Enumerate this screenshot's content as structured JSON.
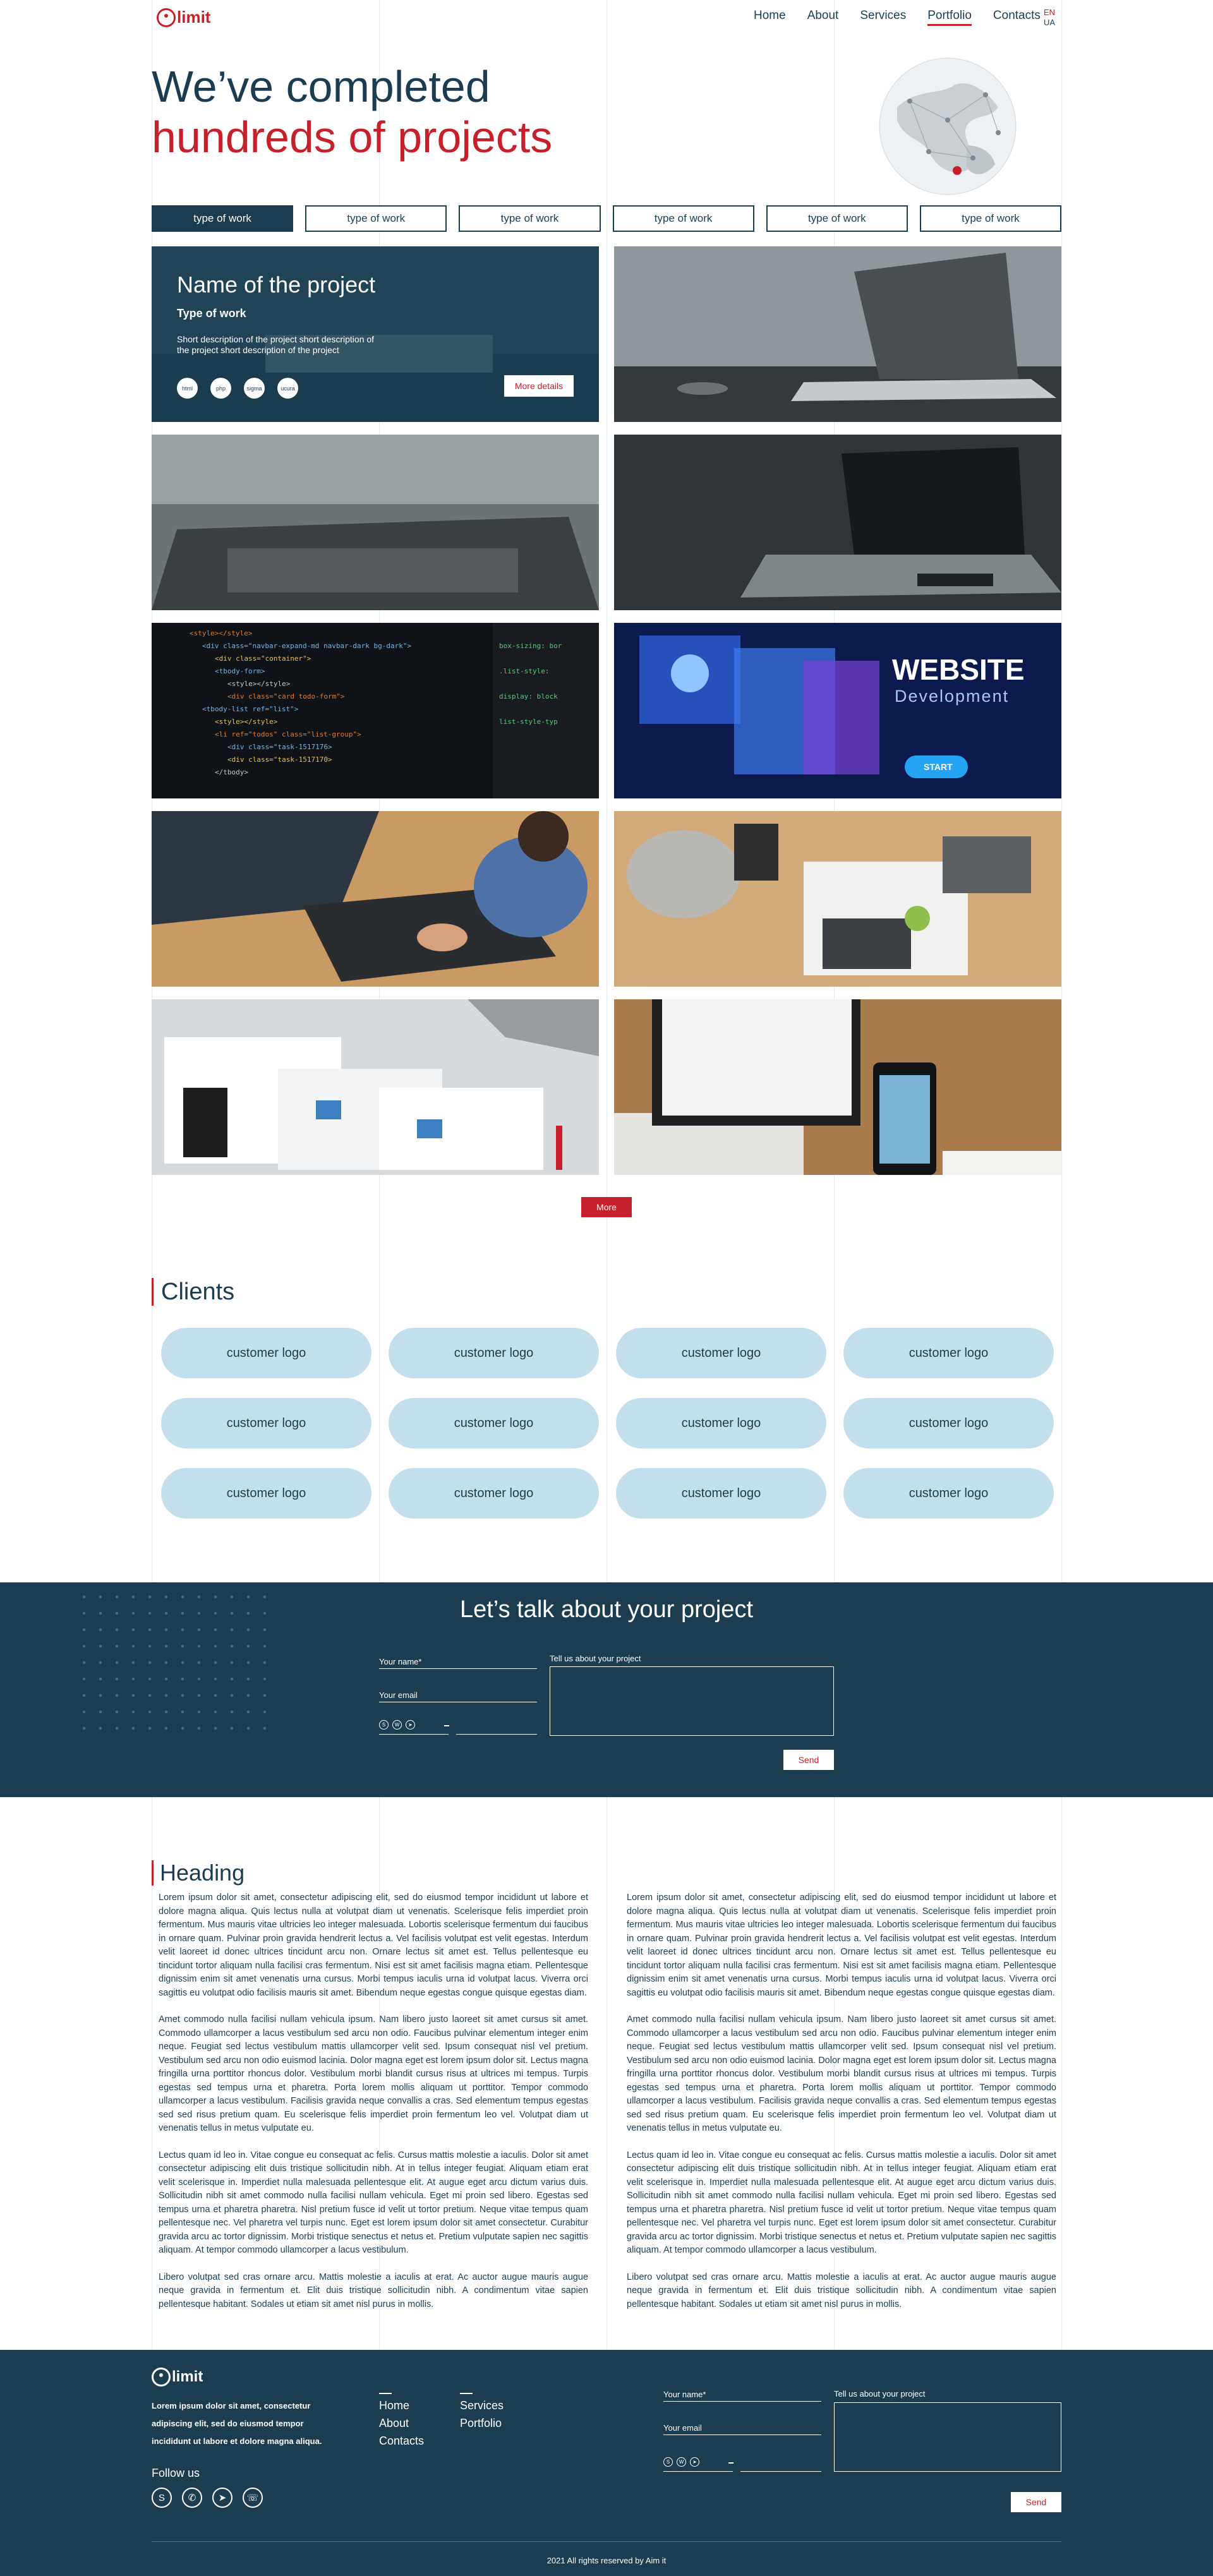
{
  "brand": {
    "name": "limit"
  },
  "nav": {
    "items": [
      "Home",
      "About",
      "Services",
      "Portfolio",
      "Contacts"
    ],
    "active": "Portfolio"
  },
  "lang": {
    "primary": "EN",
    "secondary": "UA"
  },
  "hero": {
    "line1": "We’ve completed",
    "line2": "hundreds of projects"
  },
  "filters": [
    "type of work",
    "type of work",
    "type of work",
    "type of work",
    "type of work",
    "type of work"
  ],
  "featured_project": {
    "title": "Name of the project",
    "type": "Type of work",
    "description": "Short description of the project short description of the project short description of the project",
    "tech": [
      "html",
      "php",
      "sigma",
      "ucura"
    ],
    "more_label": "More details"
  },
  "more_label": "More",
  "clients": {
    "title": "Clients",
    "logos": [
      "customer logo",
      "customer logo",
      "customer logo",
      "customer logo",
      "customer logo",
      "customer logo",
      "customer logo",
      "customer logo",
      "customer logo",
      "customer logo",
      "customer logo",
      "customer logo"
    ]
  },
  "contact": {
    "title": "Let’s talk about your project",
    "name_label": "Your name*",
    "email_label": "Your email",
    "message_label": "Tell us about your project",
    "send_label": "Send"
  },
  "article": {
    "heading": "Heading",
    "p1": "Lorem ipsum dolor sit amet, consectetur adipiscing elit, sed do eiusmod tempor incididunt ut labore et dolore magna aliqua. Quis lectus nulla at volutpat diam ut venenatis. Scelerisque felis imperdiet proin fermentum. Mus mauris vitae ultricies leo integer malesuada. Lobortis scelerisque fermentum dui faucibus in ornare quam. Pulvinar proin gravida hendrerit lectus a. Vel facilisis volutpat est velit egestas. Interdum velit laoreet id donec ultrices tincidunt arcu non. Ornare lectus sit amet est. Tellus pellentesque eu tincidunt tortor aliquam nulla facilisi cras fermentum. Nisi est sit amet facilisis magna etiam. Pellentesque dignissim enim sit amet venenatis urna cursus. Morbi tempus iaculis urna id volutpat lacus. Viverra orci sagittis eu volutpat odio facilisis mauris sit amet. Bibendum neque egestas congue quisque egestas diam.",
    "p2": "Amet commodo nulla facilisi nullam vehicula ipsum. Nam libero justo laoreet sit amet cursus sit amet. Commodo ullamcorper a lacus vestibulum sed arcu non odio. Faucibus pulvinar elementum integer enim neque. Feugiat sed lectus vestibulum mattis ullamcorper velit sed. Ipsum consequat nisl vel pretium. Vestibulum sed arcu non odio euismod lacinia. Dolor magna eget est lorem ipsum dolor sit. Lectus magna fringilla urna porttitor rhoncus dolor. Vestibulum morbi blandit cursus risus at ultrices mi tempus. Turpis egestas sed tempus urna et pharetra. Porta lorem mollis aliquam ut porttitor. Tempor commodo ullamcorper a lacus vestibulum. Facilisis gravida neque convallis a cras. Sed elementum tempus egestas sed sed risus pretium quam. Eu scelerisque felis imperdiet proin fermentum leo vel. Volutpat diam ut venenatis tellus in metus vulputate eu.",
    "p3": "Lectus quam id leo in. Vitae congue eu consequat ac felis. Cursus mattis molestie a iaculis. Dolor sit amet consectetur adipiscing elit duis tristique sollicitudin nibh. At in tellus integer feugiat. Aliquam etiam erat velit scelerisque in. Imperdiet nulla malesuada pellentesque elit. At augue eget arcu dictum varius duis. Sollicitudin nibh sit amet commodo nulla facilisi nullam vehicula. Eget mi proin sed libero. Egestas sed tempus urna et pharetra pharetra. Nisl pretium fusce id velit ut tortor pretium. Neque vitae tempus quam pellentesque nec. Vel pharetra vel turpis nunc. Eget est lorem ipsum dolor sit amet consectetur. Curabitur gravida arcu ac tortor dignissim. Morbi tristique senectus et netus et. Pretium vulputate sapien nec sagittis aliquam. At tempor commodo ullamcorper a lacus vestibulum.",
    "p4": "Libero volutpat sed cras ornare arcu. Mattis molestie a iaculis at erat. Ac auctor augue mauris augue neque gravida in fermentum et. Elit duis tristique sollicitudin nibh. A condimentum vitae sapien pellentesque habitant. Sodales ut etiam sit amet nisl purus in mollis."
  },
  "footer": {
    "brand": "limit",
    "description": "Lorem ipsum dolor sit amet, consectetur adipiscing elit, sed do eiusmod tempor incididunt ut labore et dolore magna aliqua.",
    "links_col1": [
      "Home",
      "About",
      "Contacts"
    ],
    "links_col2": [
      "Services",
      "Portfolio"
    ],
    "follow_label": "Follow us",
    "name_label": "Your name*",
    "email_label": "Your email",
    "message_label": "Tell us about your project",
    "send_label": "Send",
    "copyright": "2021 All rights reserved by Aim it"
  },
  "colors": {
    "primary": "#1c3d50",
    "accent": "#c8202a",
    "client_pill": "#c3dfec"
  },
  "icons": [
    "skype-icon",
    "whatsapp-icon",
    "telegram-icon",
    "viber-icon"
  ]
}
